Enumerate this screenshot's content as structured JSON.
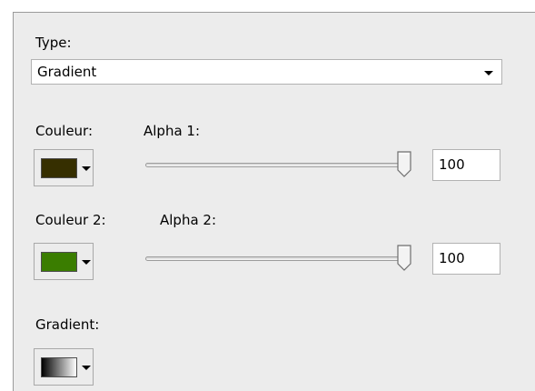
{
  "type_section": {
    "label": "Type:",
    "selected": "Gradient"
  },
  "color1": {
    "label": "Couleur:",
    "swatch": "#362f00"
  },
  "alpha1": {
    "label": "Alpha 1:",
    "value_text": "100",
    "value": 100
  },
  "color2": {
    "label": "Couleur 2:",
    "swatch": "#3a7d00"
  },
  "alpha2": {
    "label": "Alpha 2:",
    "value_text": "100",
    "value": 100
  },
  "gradient": {
    "label": "Gradient:",
    "from": "#000000",
    "to": "#ffffff"
  },
  "icons": {
    "dropdown_arrow": "chevron-down-icon",
    "slider_thumb": "slider-thumb-icon"
  }
}
